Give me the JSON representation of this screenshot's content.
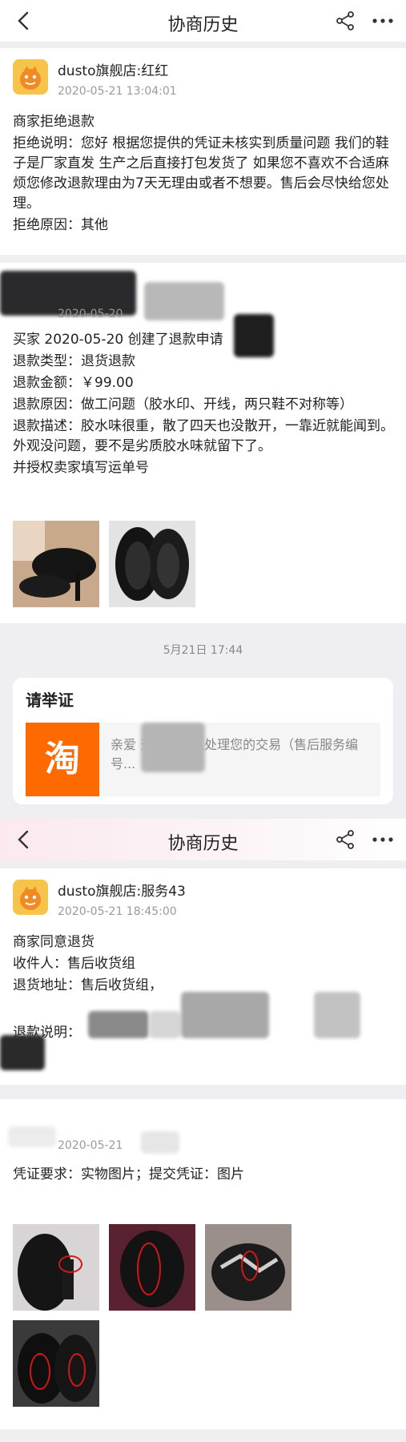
{
  "nav": {
    "title": "协商历史",
    "back_icon": "chevron-left-icon",
    "share_icon": "share-icon",
    "more_icon": "more-dots-icon"
  },
  "record1": {
    "shop": "dusto旗舰店:红红",
    "time": "2020-05-21 13:04:01",
    "lines": [
      "商家拒绝退款",
      "拒绝说明：您好 根据您提供的凭证未核实到质量问题 我们的鞋子是厂家直发 生产之后直接打包发货了 如果您不喜欢不合适麻烦您修改退款理由为7天无理由或者不想要。售后会尽快给您处理。",
      "拒绝原因：其他"
    ]
  },
  "record2": {
    "time": "2020-05-20",
    "lines": [
      "买家 2020-05-20 创建了退款申请",
      "退款类型：退货退款",
      "退款金额：￥99.00",
      "退款原因：做工问题（胶水印、开线，两只鞋不对称等）",
      "退款描述：胶水味很重，散了四天也没散开，一靠近就能闻到。外观没问题，要不是劣质胶水味就留下了。",
      "并授权卖家填写运单号"
    ]
  },
  "separator": {
    "time": "5月21日 17:44"
  },
  "evidence": {
    "title": "请举证",
    "logo_text": "淘",
    "message": "亲爱 天猫已介入处理您的交易（售后服务编号..."
  },
  "record3": {
    "shop": "dusto旗舰店:服务43",
    "time": "2020-05-21 18:45:00",
    "lines": [
      "商家同意退货",
      "收件人：售后收货组",
      "退货地址：售后收货组，",
      "退款说明："
    ]
  },
  "record4": {
    "time": "2020-05-21",
    "lines": [
      "凭证要求：实物图片；提交凭证：图片"
    ]
  },
  "colors": {
    "accent_orange": "#ff6a00",
    "avatar_yellow": "#f6c34b",
    "background": "#efeff1"
  }
}
